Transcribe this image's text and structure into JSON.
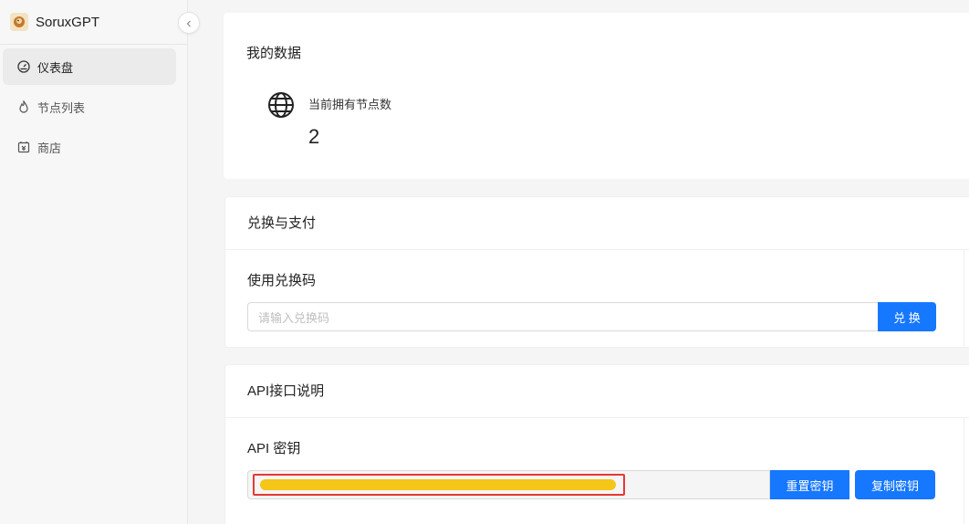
{
  "brand": {
    "name": "SoruxGPT"
  },
  "sidebar": {
    "items": [
      {
        "label": "仪表盘",
        "icon": "gauge-icon",
        "active": true
      },
      {
        "label": "节点列表",
        "icon": "flame-icon",
        "active": false
      },
      {
        "label": "商店",
        "icon": "shop-icon",
        "active": false
      }
    ]
  },
  "my_data": {
    "title": "我的数据",
    "stat_label": "当前拥有节点数",
    "stat_value": "2"
  },
  "redeem": {
    "title": "兑换与支付",
    "subtitle": "使用兑换码",
    "placeholder": "请输入兑换码",
    "button": "兑 换"
  },
  "api": {
    "title": "API接口说明",
    "subtitle": "API 密钥",
    "reset_button": "重置密钥",
    "copy_button": "复制密钥"
  },
  "colors": {
    "primary": "#1677ff",
    "highlight_border": "#e53935",
    "mask": "#f5c518"
  }
}
